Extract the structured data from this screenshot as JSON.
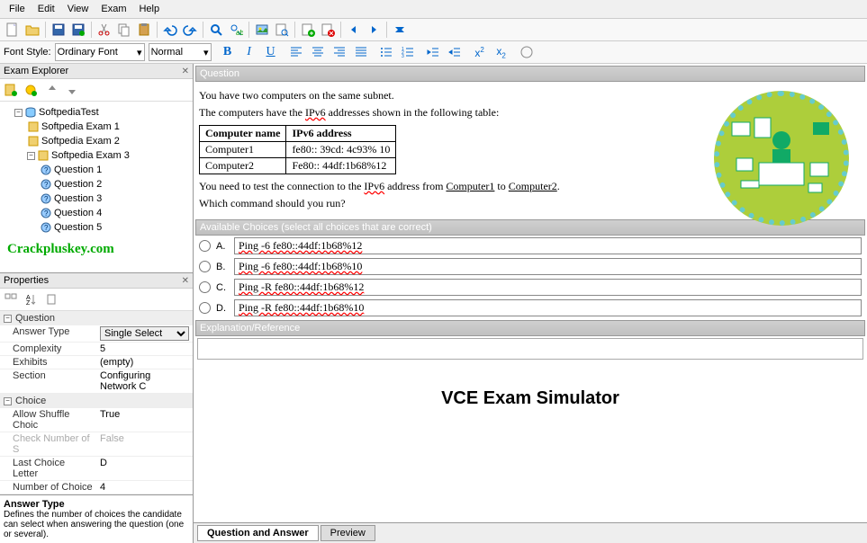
{
  "menu": {
    "items": [
      "File",
      "Edit",
      "View",
      "Exam",
      "Help"
    ]
  },
  "fontrow": {
    "label": "Font Style:",
    "font_style": "Ordinary Font",
    "weight": "Normal"
  },
  "explorer": {
    "title": "Exam Explorer",
    "root": "SoftpediaTest",
    "exams": [
      "Softpedia Exam 1",
      "Softpedia Exam 2",
      "Softpedia Exam 3"
    ],
    "questions": [
      "Question 1",
      "Question 2",
      "Question 3",
      "Question 4",
      "Question 5"
    ]
  },
  "watermark": "Crackpluskey.com",
  "properties": {
    "title": "Properties",
    "cat1": "Question",
    "answer_type_lbl": "Answer Type",
    "answer_type_val": "Single Select",
    "complexity_lbl": "Complexity",
    "complexity_val": "5",
    "exhibits_lbl": "Exhibits",
    "exhibits_val": "(empty)",
    "section_lbl": "Section",
    "section_val": "Configuring Network C",
    "cat2": "Choice",
    "shuffle_lbl": "Allow Shuffle Choic",
    "shuffle_val": "True",
    "check_lbl": "Check Number of S",
    "check_val": "False",
    "last_lbl": "Last Choice Letter",
    "last_val": "D",
    "num_lbl": "Number of Choice",
    "num_val": "4",
    "desc_title": "Answer Type",
    "desc_body": "Defines the number of choices the candidate can select when answering the question (one or several)."
  },
  "question": {
    "hdr": "Question",
    "p1": "You have two computers on the same subnet.",
    "p2a": "The computers have the ",
    "p2b": "IPv6",
    "p2c": " addresses shown in the following table:",
    "th1": "Computer name",
    "th2": "IPv6 address",
    "r1c1": "Computer1",
    "r1c2": "fe80:: 39cd: 4c93% 10",
    "r2c1": "Computer2",
    "r2c2": "Fe80:: 44df:1b68%12",
    "p3a": "You need to test the connection to the ",
    "p3b": "IPv6",
    "p3c": " address from ",
    "p3d": "Computer1",
    "p3e": " to ",
    "p3f": "Computer2",
    "p3g": ".",
    "p4": "Which command should you run?"
  },
  "choices": {
    "hdr": "Available Choices (select all choices that are correct)",
    "items": [
      {
        "l": "A.",
        "t": "Ping -6 fe80::44df:1b68%12"
      },
      {
        "l": "B.",
        "t": "Ping -6 fe80::44df:1b68%10"
      },
      {
        "l": "C.",
        "t": "Ping -R fe80::44df:1b68%12"
      },
      {
        "l": "D.",
        "t": "Ping -R fe80::44df:1b68%10"
      }
    ]
  },
  "explanation_hdr": "Explanation/Reference",
  "vce_title": "VCE Exam Simulator",
  "tabs": {
    "t1": "Question and Answer",
    "t2": "Preview"
  }
}
